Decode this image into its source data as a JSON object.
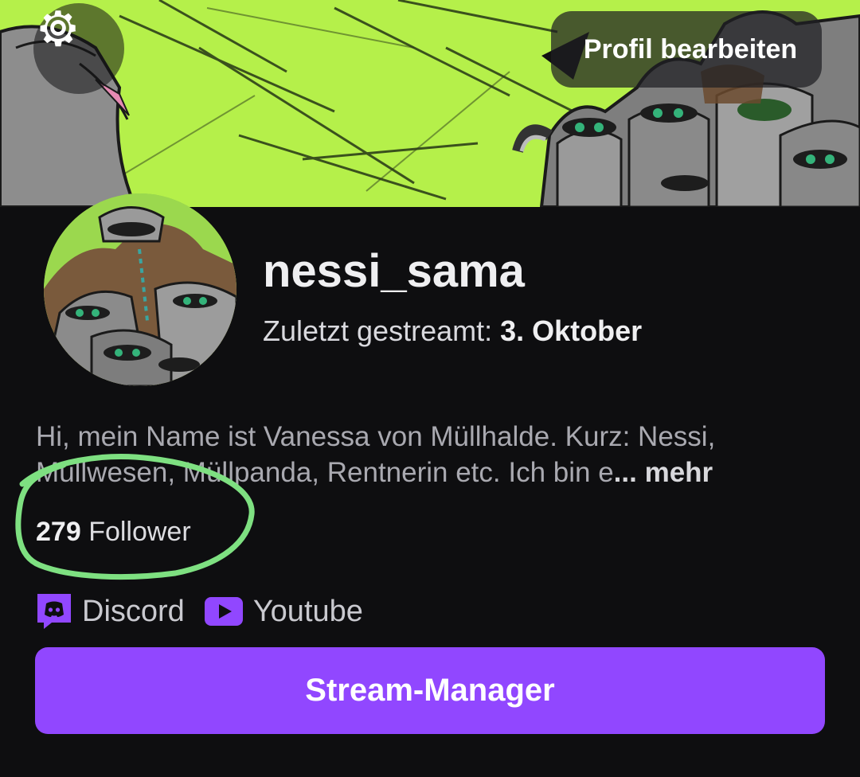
{
  "header": {
    "settings_icon": "gear-icon",
    "edit_profile_label": "Profil bearbeiten"
  },
  "profile": {
    "username": "nessi_sama",
    "last_streamed_label": "Zuletzt gestreamt:",
    "last_streamed_date": "3. Oktober",
    "bio_line1": "Hi, mein Name ist Vanessa von Müllhalde. Kurz: Nessi,",
    "bio_line2": "Müllwesen, Müllpanda, Rentnerin etc. Ich bin e",
    "bio_more": "... mehr",
    "follower_count": "279",
    "follower_label": "Follower"
  },
  "links": [
    {
      "label": "Discord",
      "icon": "discord-icon"
    },
    {
      "label": "Youtube",
      "icon": "youtube-icon"
    }
  ],
  "actions": {
    "stream_manager_label": "Stream-Manager"
  },
  "colors": {
    "background": "#0e0e10",
    "accent": "#9147ff",
    "banner_green": "#b7f24a",
    "annotation_green": "#7ee081"
  }
}
